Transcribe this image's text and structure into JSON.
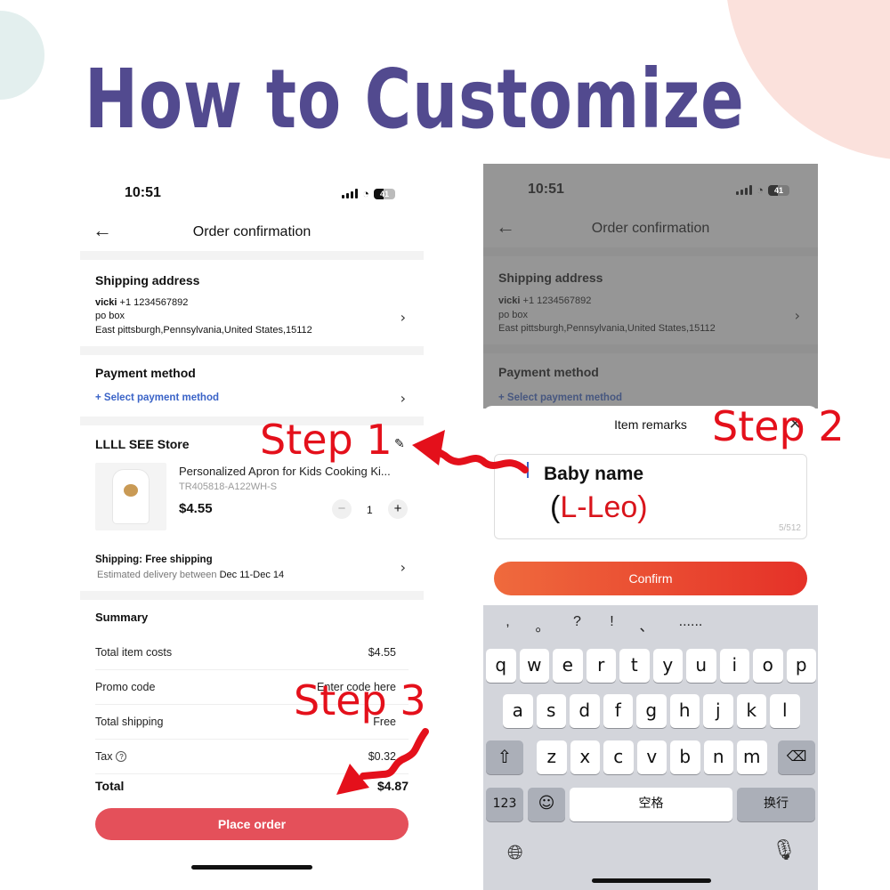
{
  "heading": "How to Customize",
  "steps": {
    "step1": "Step 1",
    "step2": "Step 2",
    "step3": "Step 3"
  },
  "colors": {
    "heading": "#524a8f",
    "annotation": "#e4101b",
    "place_order": "#e4505a",
    "confirm_from": "#ef6a3d",
    "confirm_to": "#e53128",
    "link": "#3a63c7"
  },
  "left_phone": {
    "status": {
      "time": "10:51",
      "battery": "41"
    },
    "nav": {
      "back_icon": "arrow-left",
      "title": "Order confirmation"
    },
    "shipping_address": {
      "title": "Shipping address",
      "name": "vicki",
      "phone": "+1 1234567892",
      "line1": "po box",
      "line2": "East pittsburgh,Pennsylvania,United States,15112"
    },
    "payment": {
      "title": "Payment method",
      "link": "+ Select payment method"
    },
    "store": {
      "name": "LLLL SEE Store",
      "edit_icon": "pencil",
      "product": {
        "name": "Personalized Apron for Kids Cooking Ki...",
        "sku": "TR405818-A122WH-S",
        "price": "$4.55",
        "quantity": "1",
        "minus": "−",
        "plus": "+"
      },
      "shipping_title": "Shipping: Free shipping",
      "shipping_est_prefix": "Estimated delivery between",
      "shipping_est_dates": "Dec 11-Dec 14"
    },
    "summary": {
      "title": "Summary",
      "rows": [
        {
          "label": "Total item costs",
          "value": "$4.55"
        },
        {
          "label": "Promo code",
          "value": "Enter code here"
        },
        {
          "label": "Total shipping",
          "value": "Free"
        },
        {
          "label": "Tax",
          "value": "$0.32"
        }
      ],
      "total_label": "Total",
      "total_value": "$4.87"
    },
    "place_order": "Place order"
  },
  "right_phone": {
    "status": {
      "time": "10:51",
      "battery": "41"
    },
    "nav": {
      "title": "Order confirmation"
    },
    "shipping_address": {
      "title": "Shipping address",
      "name": "vicki",
      "phone": "+1 1234567892",
      "line1": "po box",
      "line2": "East pittsburgh,Pennsylvania,United States,15112"
    },
    "payment": {
      "title": "Payment method",
      "link": "+ Select payment method"
    },
    "remarks": {
      "title": "Item remarks",
      "label": "Baby name",
      "value_open": "(",
      "value": "L-Leo",
      "value_close": ")",
      "char_count": "5/512",
      "confirm": "Confirm"
    },
    "keyboard": {
      "punctuation": [
        ",",
        "。",
        "?",
        "!",
        "、",
        "......"
      ],
      "row1": [
        "q",
        "w",
        "e",
        "r",
        "t",
        "y",
        "u",
        "i",
        "o",
        "p"
      ],
      "row2": [
        "a",
        "s",
        "d",
        "f",
        "g",
        "h",
        "j",
        "k",
        "l"
      ],
      "row3": [
        "z",
        "x",
        "c",
        "v",
        "b",
        "n",
        "m"
      ],
      "numbers": "123",
      "space": "空格",
      "return": "换行"
    }
  }
}
